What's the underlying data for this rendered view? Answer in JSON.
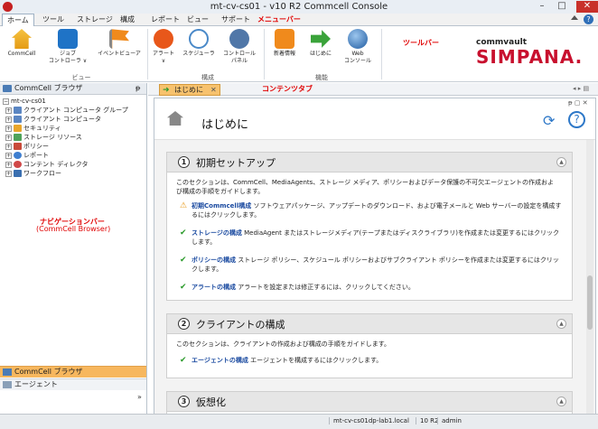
{
  "window": {
    "title": "mt-cv-cs01 - v10 R2 Commcell Console"
  },
  "menu": {
    "items": [
      "ホーム",
      "ツール",
      "ストレージ",
      "構成",
      "レポート",
      "ビュー",
      "サポート"
    ],
    "annotation": "メニューバー"
  },
  "ribbon": {
    "buttons": [
      {
        "label": "CommCell"
      },
      {
        "label1": "ジョブ",
        "label2": "コントローラ ∨"
      },
      {
        "label": "イベントビューア"
      },
      {
        "label1": "アラート",
        "label2": "∨"
      },
      {
        "label": "スケジューラ"
      },
      {
        "label1": "コントロール",
        "label2": "パネル"
      },
      {
        "label": "新着情報"
      },
      {
        "label": "はじめに"
      },
      {
        "label1": "Web",
        "label2": "コンソール"
      }
    ],
    "groups": [
      "ビュー",
      "構成",
      "機能"
    ],
    "annotation": "ツールバー"
  },
  "logo": {
    "line1": "commvault",
    "line2": "SIMPANA."
  },
  "nav": {
    "title": "CommCell ブラウザ",
    "root": "mt-cv-cs01",
    "items": [
      "クライアント コンピュータ グループ",
      "クライアント コンピュータ",
      "セキュリティ",
      "ストレージ リソース",
      "ポリシー",
      "レポート",
      "コンテント ディレクタ",
      "ワークフロー"
    ],
    "annotation1": "ナビゲーションバー",
    "annotation2": "(CommCell Browser)",
    "bottom": [
      "CommCell ブラウザ",
      "エージェント"
    ]
  },
  "tabs": {
    "welcome": "はじめに",
    "annotation": "コンテンツタブ"
  },
  "content": {
    "title": "はじめに",
    "sections": [
      {
        "num": "1",
        "title": "初期セットアップ",
        "desc": "このセクションは、CommCell、MediaAgents、ストレージ メディア、ポリシーおよびデータ保護の不可欠エージェントの作成および構成の手順をガイドします。",
        "items": [
          {
            "link": "初期Commcell構成",
            "text": "ソフトウェアパッケージ、アップデートのダウンロード、および電子メールと Web サーバーの設定を構成するにはクリックします。"
          },
          {
            "link": "ストレージの構成",
            "text": "MediaAgent またはストレージメディア(テープまたはディスクライブラリ)を作成または変更するにはクリックします。"
          },
          {
            "link": "ポリシーの構成",
            "text": "ストレージ ポリシー、スケジュール ポリシーおよびサブクライアント ポリシーを作成または変更するにはクリックします。"
          },
          {
            "link": "アラートの構成",
            "text": "アラートを設定または修正するには、クリックしてください。"
          }
        ]
      },
      {
        "num": "2",
        "title": "クライアントの構成",
        "desc": "このセクションは、クライアントの作成および構成の手順をガイドします。",
        "items": [
          {
            "link": "エージェントの構成",
            "text": "エージェントを構成するにはクリックします。"
          }
        ]
      },
      {
        "num": "3",
        "title": "仮想化"
      }
    ]
  },
  "status": {
    "host": "mt-cv-cs01dp-lab1.local",
    "version": "10 R2",
    "user": "admin"
  },
  "colors": {
    "accent": "#f7b75e",
    "brand": "#c8102e",
    "link": "#1a4aa0",
    "annotation": "#e00000"
  }
}
